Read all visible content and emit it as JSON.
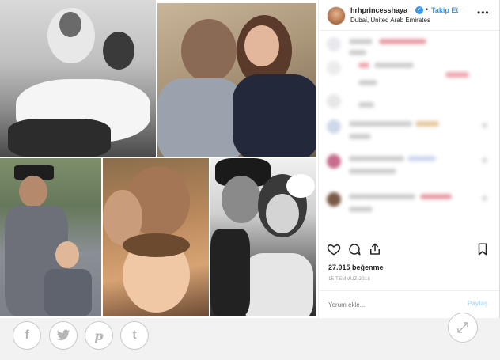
{
  "post": {
    "username": "hrhprincesshaya",
    "verified_mark": "✓",
    "separator": "•",
    "follow_label": "Takip Et",
    "location": "Dubai, United Arab Emirates",
    "more_icon": "more-horizontal-icon",
    "likes": "27.015 beğenme",
    "date": "15 TEMMUZ 2018",
    "comment_placeholder": "Yorum ekle...",
    "post_label": "Paylaş"
  },
  "actions": {
    "icons": [
      "heart-icon",
      "comment-icon",
      "share-icon",
      "bookmark-icon"
    ]
  },
  "share": {
    "buttons": [
      {
        "name": "facebook",
        "glyph": "f"
      },
      {
        "name": "twitter",
        "glyph": "t"
      },
      {
        "name": "pinterest",
        "glyph": "p"
      },
      {
        "name": "tumblr",
        "glyph": "t"
      }
    ],
    "expand_icon": "expand-icon"
  },
  "colors": {
    "accent": "#3897f0",
    "text": "#262626",
    "muted": "#999999",
    "share_icon": "#b5b5b5"
  }
}
